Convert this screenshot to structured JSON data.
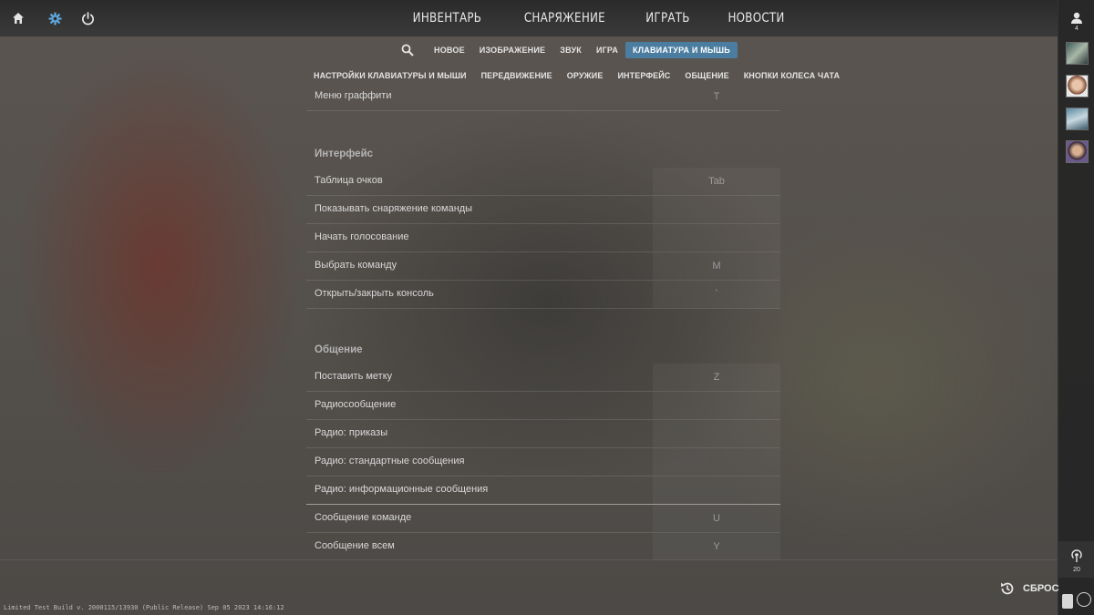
{
  "topbar": {
    "icons": [
      "home-icon",
      "gear-icon",
      "power-icon"
    ],
    "nav": [
      "ИНВЕНТАРЬ",
      "СНАРЯЖЕНИЕ",
      "ИГРАТЬ",
      "НОВОСТИ"
    ]
  },
  "right_rail": {
    "friends_count": "4",
    "watch_count": "20"
  },
  "settings_nav": [
    "НОВОЕ",
    "ИЗОБРАЖЕНИЕ",
    "ЗВУК",
    "ИГРА",
    "КЛАВИАТУРА И МЫШЬ"
  ],
  "settings_nav_active": "КЛАВИАТУРА И МЫШЬ",
  "keyboard_tabs": [
    "НАСТРОЙКИ КЛАВИАТУРЫ И МЫШИ",
    "ПЕРЕДВИЖЕНИЕ",
    "ОРУЖИЕ",
    "ИНТЕРФЕЙС",
    "ОБЩЕНИЕ",
    "КНОПКИ КОЛЕСА ЧАТА"
  ],
  "rows_top": [
    {
      "label": "Меню граффити",
      "key": "T"
    }
  ],
  "section_interface": {
    "title": "Интерфейс",
    "rows": [
      {
        "label": "Таблица очков",
        "key": "Tab"
      },
      {
        "label": "Показывать снаряжение команды",
        "key": ""
      },
      {
        "label": "Начать голосование",
        "key": ""
      },
      {
        "label": "Выбрать команду",
        "key": "M"
      },
      {
        "label": "Открыть/закрыть консоль",
        "key": "`"
      }
    ]
  },
  "section_comm": {
    "title": "Общение",
    "rows": [
      {
        "label": "Поставить метку",
        "key": "Z"
      },
      {
        "label": "Радиосообщение",
        "key": ""
      },
      {
        "label": "Радио: приказы",
        "key": ""
      },
      {
        "label": "Радио: стандартные сообщения",
        "key": ""
      },
      {
        "label": "Радио: информационные сообщения",
        "key": ""
      },
      {
        "label": "Сообщение команде",
        "key": "U"
      },
      {
        "label": "Сообщение всем",
        "key": "Y"
      }
    ]
  },
  "reset_label": "СБРОС",
  "build_info": "Limited Test Build v. 2000115/13930 (Public Release) Sep 05 2023 14:16:12",
  "colors": {
    "accent": "#4b7da0",
    "topbar_bg": "#2a2a2a"
  }
}
